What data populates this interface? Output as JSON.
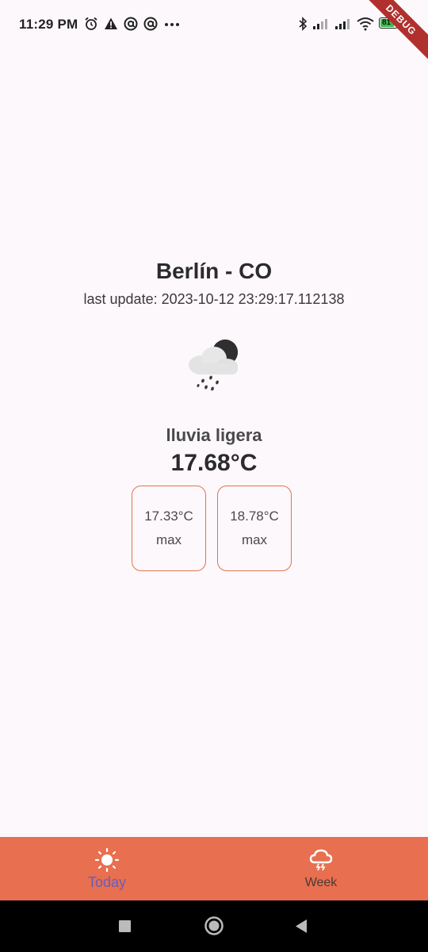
{
  "status_bar": {
    "time": "11:29 PM",
    "battery_level": "81",
    "left_icons": [
      "alarm-icon",
      "warning-icon",
      "at-sign-icon",
      "at-sign-icon",
      "more-dots-icon"
    ],
    "right_icons": [
      "bluetooth-icon",
      "signal-icon",
      "signal-icon",
      "wifi-icon",
      "battery-icon"
    ]
  },
  "debug_banner": "DEBUG",
  "weather": {
    "city": "Berlín - CO",
    "last_update_label": "last update:",
    "last_update_value": "2023-10-12 23:29:17.112138",
    "icon": "cloud-night-rain-icon",
    "description": "lluvia ligera",
    "temperature": "17.68°C",
    "min": {
      "value": "17.33°C",
      "label": "max"
    },
    "max": {
      "value": "18.78°C",
      "label": "max"
    }
  },
  "bottom_nav": {
    "items": [
      {
        "label": "Today",
        "icon": "sun-icon",
        "selected": true
      },
      {
        "label": "Week",
        "icon": "storm-cloud-icon",
        "selected": false
      }
    ]
  },
  "colors": {
    "accent": "#e86f4f",
    "selected_label": "#6a5db8",
    "card_border": "#e07352",
    "background": "#fdf8fb"
  },
  "system_nav": [
    "recents-button",
    "home-button",
    "back-button"
  ]
}
